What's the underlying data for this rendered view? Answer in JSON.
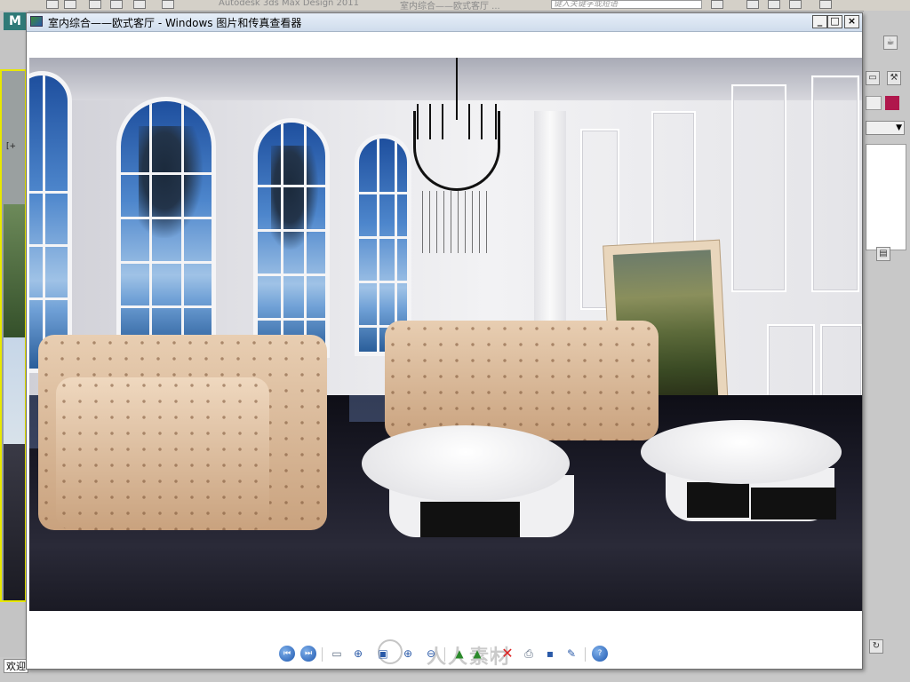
{
  "background_app": {
    "title": "Autodesk 3ds Max Design 2011",
    "doc_tab": "室内综合——欧式客厅 ...",
    "search_placeholder": "键入关键字或短语",
    "logo": "M",
    "viewport_label": "[+",
    "status_text": "欢迎",
    "right_dropdown": "▼",
    "accent_swatch": "#b0174c"
  },
  "viewer": {
    "title": "室内综合——欧式客厅 - Windows 图片和传真查看器",
    "buttons": {
      "minimize": "_",
      "maximize": "□",
      "close": "×"
    },
    "toolbar": [
      {
        "name": "previous-image-button",
        "icon": "previous-icon",
        "glyph": "⏮"
      },
      {
        "name": "next-image-button",
        "icon": "next-icon",
        "glyph": "⏭"
      },
      {
        "name": "best-fit-button",
        "icon": "best-fit-icon",
        "glyph": "▭"
      },
      {
        "name": "actual-size-button",
        "icon": "actual-size-icon",
        "glyph": "⊕"
      },
      {
        "name": "slideshow-button",
        "icon": "slideshow-icon",
        "glyph": "▣"
      },
      {
        "name": "zoom-in-button",
        "icon": "zoom-in-icon",
        "glyph": "⊕"
      },
      {
        "name": "zoom-out-button",
        "icon": "zoom-out-icon",
        "glyph": "⊖"
      },
      {
        "name": "rotate-clockwise-button",
        "icon": "rotate-cw-icon",
        "glyph": "▲"
      },
      {
        "name": "rotate-counterclockwise-button",
        "icon": "rotate-ccw-icon",
        "glyph": "▲"
      },
      {
        "name": "delete-button",
        "icon": "delete-icon",
        "glyph": "✕"
      },
      {
        "name": "print-button",
        "icon": "print-icon",
        "glyph": "⎙"
      },
      {
        "name": "save-button",
        "icon": "save-icon",
        "glyph": "▪"
      },
      {
        "name": "edit-button",
        "icon": "edit-icon",
        "glyph": "✎"
      },
      {
        "name": "help-button",
        "icon": "help-icon",
        "glyph": "?"
      }
    ],
    "watermark": "人人素材"
  }
}
